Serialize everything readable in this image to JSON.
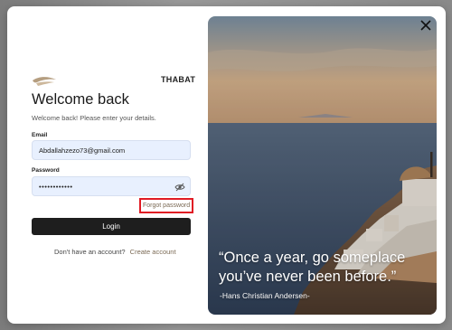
{
  "brand": {
    "name": "THABAT",
    "logo_icon": "wing-logo-icon"
  },
  "login": {
    "title": "Welcome back",
    "subtitle": "Welcome back! Please enter your details.",
    "email_label": "Email",
    "email_value": "Abdallahzezo73@gmail.com",
    "password_label": "Password",
    "password_value": "••••••••••••",
    "forgot_label": "Forgot password",
    "login_label": "Login",
    "signup_prompt": "Don't have an account?",
    "signup_link": "Create account"
  },
  "hero": {
    "quote": "“Once a year, go someplace you’ve never been before.”",
    "author": "-Hans Christian Andersen-"
  },
  "colors": {
    "button": "#1e1e1e",
    "link": "#7b6a55",
    "input_bg": "#e8f0fe",
    "highlight": "#e01b24"
  }
}
